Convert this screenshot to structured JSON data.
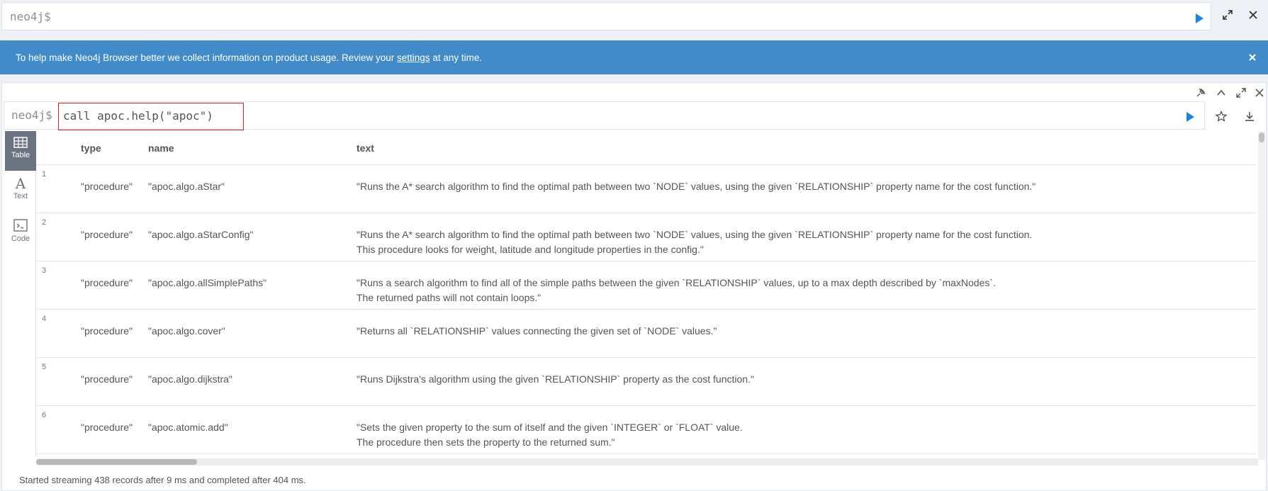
{
  "editor": {
    "prompt": "neo4j$"
  },
  "banner": {
    "text_before": "To help make Neo4j Browser better we collect information on product usage. Review your ",
    "link": "settings",
    "text_after": " at any time."
  },
  "frame": {
    "prompt": "neo4j$",
    "query": "call apoc.help(\"apoc\")",
    "view_tabs": [
      {
        "label": "Table",
        "icon": "table-icon",
        "active": true
      },
      {
        "label": "Text",
        "icon": "text-icon",
        "active": false
      },
      {
        "label": "Code",
        "icon": "code-icon",
        "active": false
      }
    ],
    "columns": [
      "type",
      "name",
      "text"
    ],
    "rows": [
      {
        "n": "1",
        "type": "\"procedure\"",
        "name": "\"apoc.algo.aStar\"",
        "text": [
          "\"Runs the A* search algorithm to find the optimal path between two `NODE` values, using the given `RELATIONSHIP` property name for the cost function.\""
        ]
      },
      {
        "n": "2",
        "type": "\"procedure\"",
        "name": "\"apoc.algo.aStarConfig\"",
        "text": [
          "\"Runs the A* search algorithm to find the optimal path between two `NODE` values, using the given `RELATIONSHIP` property name for the cost function.",
          "This procedure looks for weight, latitude and longitude properties in the config.\""
        ]
      },
      {
        "n": "3",
        "type": "\"procedure\"",
        "name": "\"apoc.algo.allSimplePaths\"",
        "text": [
          "\"Runs a search algorithm to find all of the simple paths between the given `RELATIONSHIP` values, up to a max depth described by `maxNodes`.",
          "The returned paths will not contain loops.\""
        ]
      },
      {
        "n": "4",
        "type": "\"procedure\"",
        "name": "\"apoc.algo.cover\"",
        "text": [
          "\"Returns all `RELATIONSHIP` values connecting the given set of `NODE` values.\""
        ]
      },
      {
        "n": "5",
        "type": "\"procedure\"",
        "name": "\"apoc.algo.dijkstra\"",
        "text": [
          "\"Runs Dijkstra's algorithm using the given `RELATIONSHIP` property as the cost function.\""
        ]
      },
      {
        "n": "6",
        "type": "\"procedure\"",
        "name": "\"apoc.atomic.add\"",
        "text": [
          "\"Sets the given property to the sum of itself and the given `INTEGER` or `FLOAT` value.",
          "The procedure then sets the property to the returned sum.\""
        ]
      }
    ],
    "status": "Started streaming 438 records after 9 ms and completed after 404 ms."
  },
  "colors": {
    "banner": "#428bca",
    "run": "#1a84e2",
    "query_highlight": "#d9221c",
    "active_tab": "#6b7280"
  },
  "icons": [
    "play-icon",
    "expand-icon",
    "close-icon",
    "pin-icon",
    "collapse-icon",
    "star-icon",
    "download-icon"
  ]
}
